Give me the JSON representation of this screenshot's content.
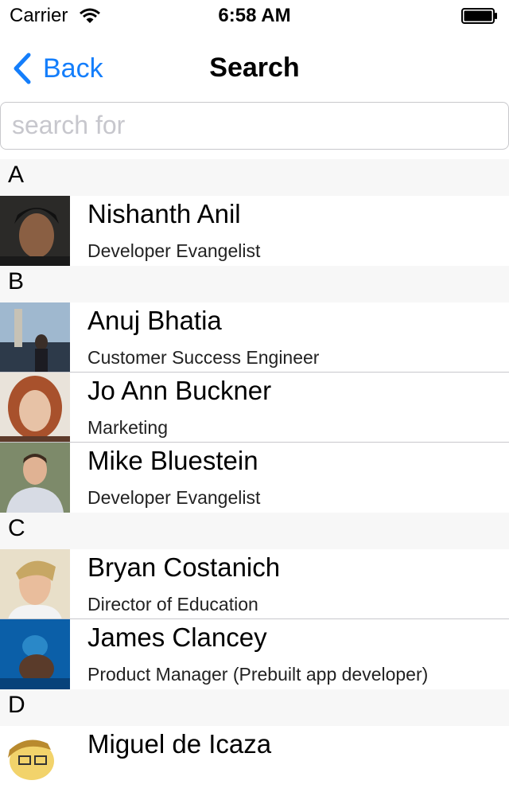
{
  "status_bar": {
    "carrier": "Carrier",
    "time": "6:58 AM"
  },
  "nav": {
    "back_label": "Back",
    "title": "Search"
  },
  "search": {
    "placeholder": "search for",
    "value": ""
  },
  "sections": [
    {
      "letter": "A",
      "rows": [
        {
          "name": "Nishanth Anil",
          "title": "Developer Evangelist"
        }
      ]
    },
    {
      "letter": "B",
      "rows": [
        {
          "name": "Anuj Bhatia",
          "title": "Customer Success Engineer"
        },
        {
          "name": "Jo Ann Buckner",
          "title": "Marketing"
        },
        {
          "name": "Mike Bluestein",
          "title": "Developer Evangelist"
        }
      ]
    },
    {
      "letter": "C",
      "rows": [
        {
          "name": "Bryan Costanich",
          "title": "Director of Education"
        },
        {
          "name": "James Clancey",
          "title": "Product Manager (Prebuilt app developer)"
        }
      ]
    },
    {
      "letter": "D",
      "rows": [
        {
          "name": "Miguel de Icaza",
          "title": ""
        }
      ]
    }
  ],
  "colors": {
    "accent": "#147efb",
    "section_bg": "#f7f7f7",
    "separator": "#c8c7cc"
  }
}
